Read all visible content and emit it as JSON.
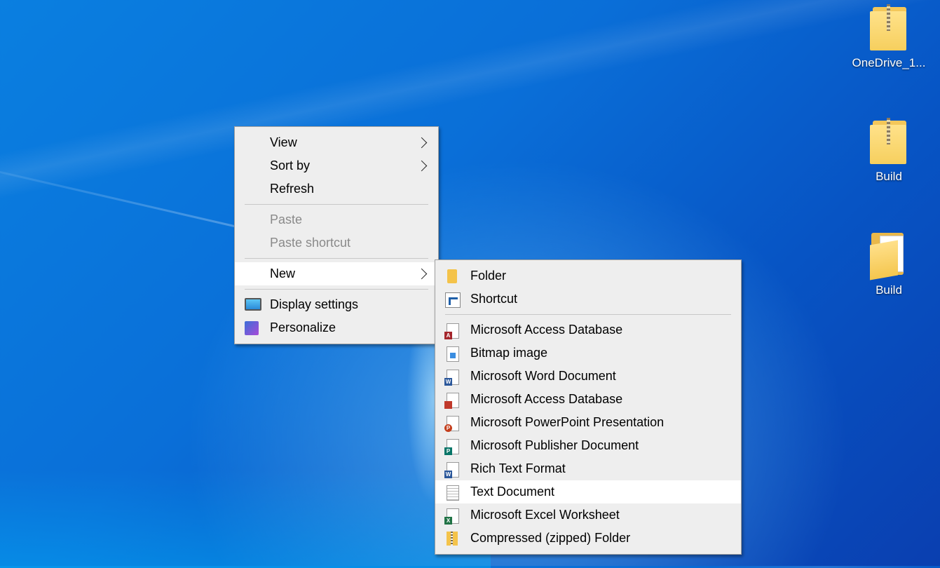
{
  "desktop": {
    "icons": [
      {
        "label": "OneDrive_1...",
        "icon": "zip-folder-icon"
      },
      {
        "label": "Build",
        "icon": "zip-folder-icon"
      },
      {
        "label": "Build",
        "icon": "open-folder-icon"
      }
    ]
  },
  "context_menu": {
    "items": [
      {
        "label": "View",
        "submenu": true
      },
      {
        "label": "Sort by",
        "submenu": true
      },
      {
        "label": "Refresh"
      },
      {
        "label": "Paste",
        "disabled": true
      },
      {
        "label": "Paste shortcut",
        "disabled": true
      },
      {
        "label": "New",
        "submenu": true,
        "highlighted": true
      },
      {
        "label": "Display settings",
        "icon": "monitor-icon"
      },
      {
        "label": "Personalize",
        "icon": "personalize-icon"
      }
    ]
  },
  "new_submenu": {
    "items": [
      {
        "label": "Folder",
        "icon": "folder-icon"
      },
      {
        "label": "Shortcut",
        "icon": "shortcut-icon"
      },
      {
        "label": "Microsoft Access Database",
        "icon": "access-icon"
      },
      {
        "label": "Bitmap image",
        "icon": "bitmap-icon"
      },
      {
        "label": "Microsoft Word Document",
        "icon": "word-icon"
      },
      {
        "label": "Microsoft Access Database",
        "icon": "access-icon"
      },
      {
        "label": "Microsoft PowerPoint Presentation",
        "icon": "powerpoint-icon"
      },
      {
        "label": "Microsoft Publisher Document",
        "icon": "publisher-icon"
      },
      {
        "label": "Rich Text Format",
        "icon": "word-icon"
      },
      {
        "label": "Text Document",
        "icon": "text-document-icon",
        "highlighted": true
      },
      {
        "label": "Microsoft Excel Worksheet",
        "icon": "excel-icon"
      },
      {
        "label": "Compressed (zipped) Folder",
        "icon": "zip-folder-icon"
      }
    ]
  }
}
